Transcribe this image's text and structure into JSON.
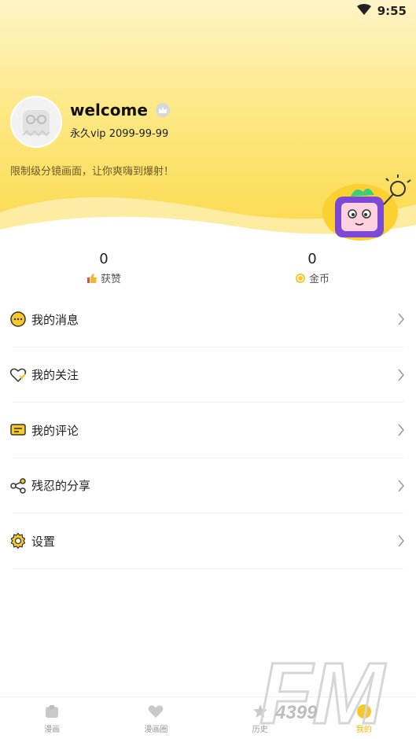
{
  "status_bar": {
    "time": "9:55"
  },
  "profile": {
    "username": "welcome",
    "vip": "永久vip 2099-99-99",
    "slogan": "限制级分镜画面，让你爽嗨到爆射！"
  },
  "stats": [
    {
      "value": "0",
      "label": "获赞",
      "icon": "thumbs-up-icon"
    },
    {
      "value": "0",
      "label": "金币",
      "icon": "coin-icon"
    }
  ],
  "menu": [
    {
      "label": "我的消息",
      "icon": "message-icon"
    },
    {
      "label": "我的关注",
      "icon": "heart-follow-icon"
    },
    {
      "label": "我的评论",
      "icon": "comment-icon"
    },
    {
      "label": "残忍的分享",
      "icon": "share-icon"
    },
    {
      "label": "设置",
      "icon": "gear-icon"
    }
  ],
  "bottom_nav": [
    {
      "label": "漫画",
      "icon": "comic-icon"
    },
    {
      "label": "漫画圈",
      "icon": "circle-icon"
    },
    {
      "label": "历史",
      "icon": "history-icon"
    },
    {
      "label": "我的",
      "icon": "profile-icon",
      "active": true
    }
  ],
  "watermark": {
    "text": "FM",
    "subtext": "4399"
  },
  "colors": {
    "accent": "#f0b400",
    "header_top": "#fff4c6",
    "header_bottom": "#fbd94a"
  }
}
